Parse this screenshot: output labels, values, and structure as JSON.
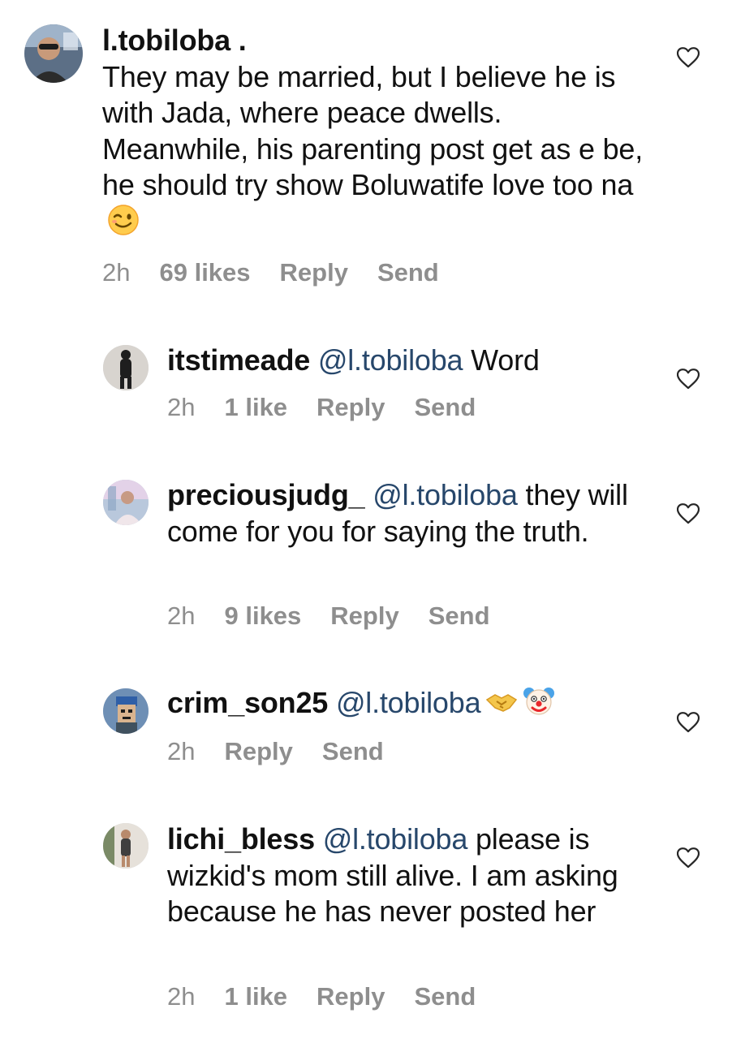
{
  "comments": [
    {
      "username": "l.tobiloba .",
      "mention": "",
      "text": "They may be married, but I believe he is with Jada, where peace dwells. Meanwhile, his parenting post get as e be, he should try show Boluwatife love too na",
      "emoji": "winking-face-emoji",
      "time": "2h",
      "likes": "69 likes",
      "reply_label": "Reply",
      "send_label": "Send"
    },
    {
      "username": "itstimeade",
      "mention": "@l.tobiloba",
      "text": "Word",
      "time": "2h",
      "likes": "1 like",
      "reply_label": "Reply",
      "send_label": "Send"
    },
    {
      "username": "preciousjudg_",
      "mention": "@l.tobiloba",
      "text": "they will come for you for saying the truth.",
      "time": "2h",
      "likes": "9 likes",
      "reply_label": "Reply",
      "send_label": "Send"
    },
    {
      "username": "crim_son25",
      "mention": "@l.tobiloba",
      "text": "",
      "emojis": [
        "handshake-emoji",
        "clown-face-emoji"
      ],
      "time": "2h",
      "likes": "",
      "reply_label": "Reply",
      "send_label": "Send"
    },
    {
      "username": "lichi_bless",
      "mention": "@l.tobiloba",
      "text": "please is wizkid's mom still alive. I am asking because he has never posted her",
      "time": "2h",
      "likes": "1 like",
      "reply_label": "Reply",
      "send_label": "Send"
    }
  ],
  "colors": {
    "mention": "#27476b",
    "meta": "#8e8e8e",
    "text": "#111111"
  },
  "icons": {
    "like": "heart-outline-icon"
  }
}
